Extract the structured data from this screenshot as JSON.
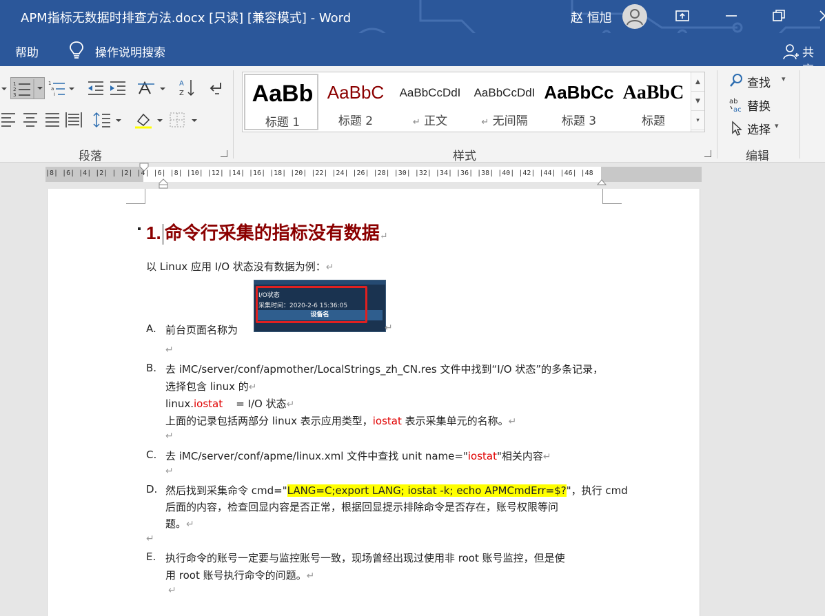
{
  "window": {
    "title": "APM指标无数据时排查方法.docx [只读] [兼容模式]  -  Word",
    "user": "赵 恒旭"
  },
  "tellbar": {
    "help": "帮助",
    "tell_me": "操作说明搜索",
    "share": "共享"
  },
  "ribbon": {
    "paragraph_label": "段落",
    "styles_label": "样式",
    "editing_label": "编辑",
    "styles": [
      {
        "preview": "AaBb",
        "name": "标题 1"
      },
      {
        "preview": "AaBbC",
        "name": "标题 2"
      },
      {
        "preview": "AaBbCcDdI",
        "name": "正文"
      },
      {
        "preview": "AaBbCcDdI",
        "name": "无间隔"
      },
      {
        "preview": "AaBbCc",
        "name": "标题 3"
      },
      {
        "preview": "AaBbC",
        "name": "标题"
      }
    ],
    "find": "查找",
    "replace": "替换",
    "select": "选择"
  },
  "ruler": {
    "labels": "|8|  |6|  |4|  |2|  |   |2|  |4|  |6|  |8|  |10| |12| |14| |16| |18| |20| |22| |24| |26| |28| |30| |32| |34| |36| |38| |40| |42| |44| |46| |48"
  },
  "doc": {
    "heading_num": "1.",
    "heading": "命令行采集的指标没有数据",
    "intro": "以 Linux 应用 I/O 状态没有数据为例：",
    "a_letter": "A.",
    "a_text": "前台页面名称为",
    "shot_title": "I/O状态",
    "shot_time": "采集时间：2020-2-6 15:36:05",
    "shot_col": "设备名",
    "b_letter": "B.",
    "b_line1": "去 iMC/server/conf/apmother/LocalStrings_zh_CN.res 文件中找到“I/O 状态”的多条记录，",
    "b_line2": "选择包含 linux 的",
    "b_line3_pre": "linux.",
    "b_line3_red": "iostat",
    "b_line3_post": "    = I/O 状态",
    "b_line4_pre": "上面的记录包括两部分 linux 表示应用类型，",
    "b_line4_red": "iostat",
    "b_line4_post": " 表示采集单元的名称。",
    "c_letter": "C.",
    "c_pre": "去 iMC/server/conf/apme/linux.xml 文件中查找 unit name=\"",
    "c_red": "iostat",
    "c_post": "\"相关内容",
    "d_letter": "D.",
    "d_pre": "然后找到采集命令 cmd=\"",
    "d_hl": "LANG=C;export LANG; iostat -k; echo APMCmdErr=$?",
    "d_post": "\"，执行 cmd",
    "d_line2": "后面的内容，检查回显内容是否正常，根据回显提示排除命令是否存在，账号权限等问",
    "d_line3": "题。",
    "e_letter": "E.",
    "e_line1": "执行命令的账号一定要与监控账号一致，现场曾经出现过使用非 root 账号监控，但是使",
    "e_line2": "用 root 账号执行命令的问题。",
    "para_mark": "↵"
  }
}
